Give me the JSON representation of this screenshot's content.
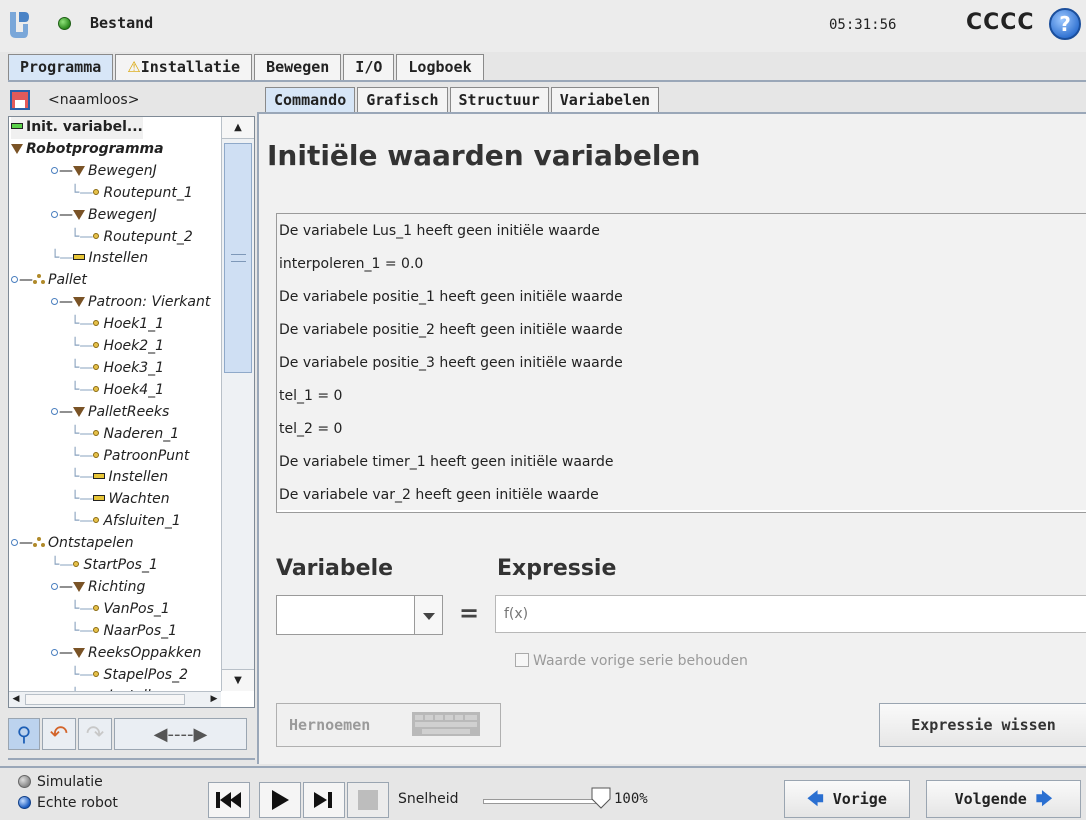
{
  "header": {
    "status_text": "Bestand",
    "clock": "05:31:56",
    "robot_name": "CCCC",
    "help_label": "?"
  },
  "top_tabs": [
    "Programma",
    "Installatie",
    "Bewegen",
    "I/O",
    "Logboek"
  ],
  "left": {
    "file_name": "<naamloos>",
    "tree": [
      {
        "label": "Init. variabel...",
        "icon": "bar-green"
      },
      {
        "label": "Robotprogramma",
        "icon": "triangle"
      },
      {
        "label": "BewegenJ",
        "icon": "triangle"
      },
      {
        "label": "Routepunt_1",
        "icon": "dot"
      },
      {
        "label": "BewegenJ",
        "icon": "triangle"
      },
      {
        "label": "Routepunt_2",
        "icon": "dot"
      },
      {
        "label": "Instellen",
        "icon": "bar"
      },
      {
        "label": "Pallet",
        "icon": "pallet"
      },
      {
        "label": "Patroon: Vierkant",
        "icon": "triangle"
      },
      {
        "label": "Hoek1_1",
        "icon": "dot"
      },
      {
        "label": "Hoek2_1",
        "icon": "dot"
      },
      {
        "label": "Hoek3_1",
        "icon": "dot"
      },
      {
        "label": "Hoek4_1",
        "icon": "dot"
      },
      {
        "label": "PalletReeks",
        "icon": "triangle"
      },
      {
        "label": "Naderen_1",
        "icon": "dot"
      },
      {
        "label": "PatroonPunt",
        "icon": "dot"
      },
      {
        "label": "Instellen",
        "icon": "bar"
      },
      {
        "label": "Wachten",
        "icon": "bar"
      },
      {
        "label": "Afsluiten_1",
        "icon": "dot"
      },
      {
        "label": "Ontstapelen",
        "icon": "pallet"
      },
      {
        "label": "StartPos_1",
        "icon": "dot"
      },
      {
        "label": "Richting",
        "icon": "triangle"
      },
      {
        "label": "VanPos_1",
        "icon": "dot"
      },
      {
        "label": "NaarPos_1",
        "icon": "dot"
      },
      {
        "label": "ReeksOppakken",
        "icon": "triangle"
      },
      {
        "label": "StapelPos_2",
        "icon": "dot"
      },
      {
        "label": "Instellen",
        "icon": "bar"
      }
    ],
    "tools": {
      "search_icon": "search-icon",
      "undo_icon": "undo-icon",
      "redo_icon": "redo-icon",
      "move_icon": "move-arrows-icon"
    }
  },
  "sub_tabs": [
    "Commando",
    "Grafisch",
    "Structuur",
    "Variabelen"
  ],
  "main": {
    "title": "Initiële waarden variabelen",
    "variables": [
      "De variabele Lus_1 heeft geen initiële waarde",
      "interpoleren_1 = 0.0",
      "De variabele positie_1 heeft geen initiële waarde",
      "De variabele positie_2 heeft geen initiële waarde",
      "De variabele positie_3 heeft geen initiële waarde",
      "tel_1 = 0",
      "tel_2 = 0",
      "De variabele timer_1 heeft geen initiële waarde",
      "De variabele var_2 heeft geen initiële waarde"
    ],
    "variable_label": "Variabele",
    "expression_label": "Expressie",
    "equals": "=",
    "expression_placeholder": "f(x)",
    "keep_value_label": "Waarde vorige serie behouden",
    "rename_button": "Hernoemen",
    "clear_button": "Expressie wissen"
  },
  "footer": {
    "mode_simulation": "Simulatie",
    "mode_real": "Echte robot",
    "speed_label": "Snelheid",
    "speed_value": "100%",
    "speed_fraction": 1.0,
    "prev_button": "Vorige",
    "next_button": "Volgende"
  },
  "colors": {
    "accent": "#2a6fd1",
    "tab_active": "#d7e6f7",
    "warning": "#d9a400"
  }
}
